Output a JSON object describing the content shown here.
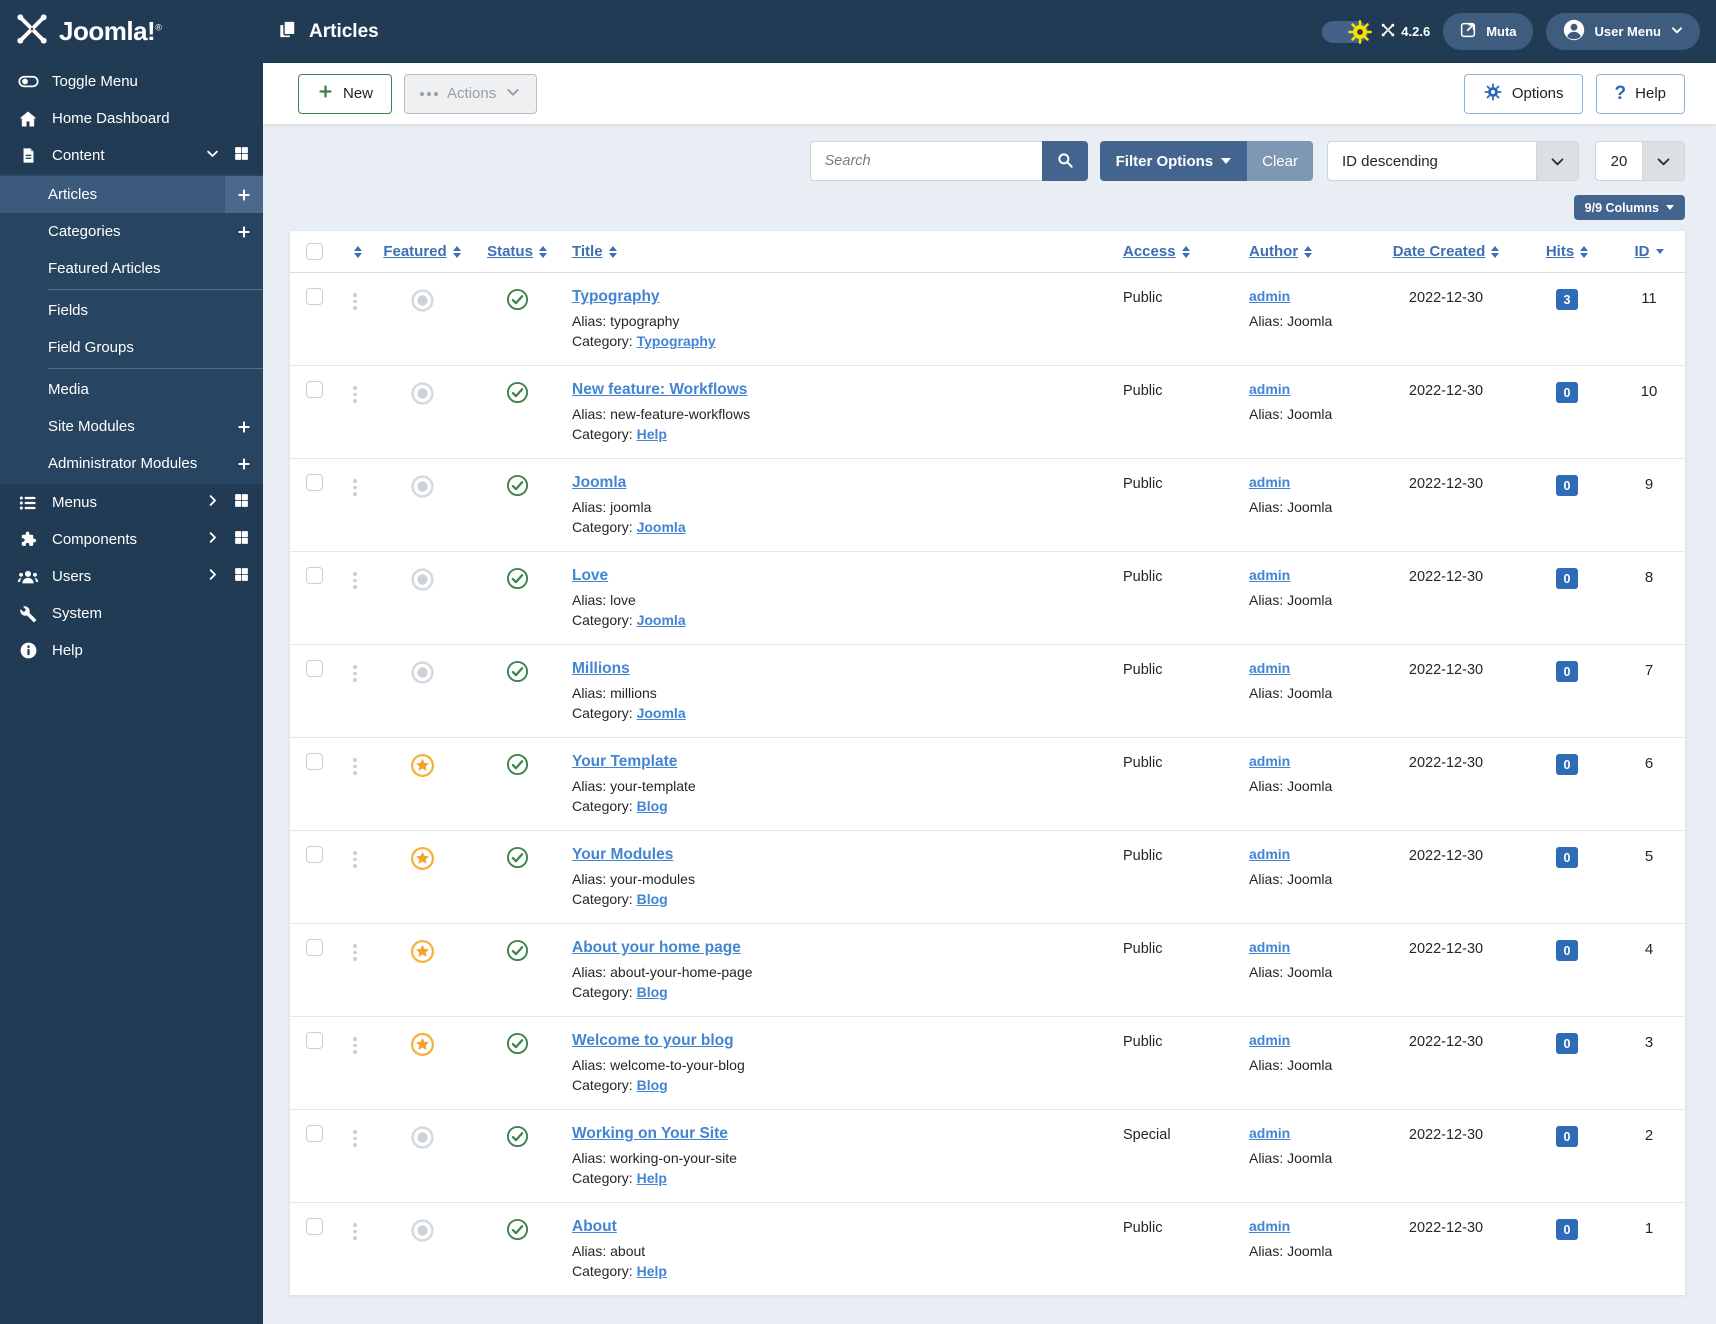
{
  "topbar": {
    "logo_text": "Joomla!",
    "reg_mark": "®",
    "page_title": "Articles",
    "version": "4.2.6",
    "muta_label": "Muta",
    "user_menu_label": "User Menu"
  },
  "sidebar": {
    "items": [
      {
        "label": "Toggle Menu"
      },
      {
        "label": "Home Dashboard"
      },
      {
        "label": "Content"
      },
      {
        "label": "Articles"
      },
      {
        "label": "Categories"
      },
      {
        "label": "Featured Articles"
      },
      {
        "label": "Fields"
      },
      {
        "label": "Field Groups"
      },
      {
        "label": "Media"
      },
      {
        "label": "Site Modules"
      },
      {
        "label": "Administrator Modules"
      },
      {
        "label": "Menus"
      },
      {
        "label": "Components"
      },
      {
        "label": "Users"
      },
      {
        "label": "System"
      },
      {
        "label": "Help"
      }
    ]
  },
  "toolbar": {
    "new_label": "New",
    "actions_label": "Actions",
    "options_label": "Options",
    "help_label": "Help",
    "help_icon_glyph": "?"
  },
  "filters": {
    "search_placeholder": "Search",
    "filter_options_label": "Filter Options",
    "clear_label": "Clear",
    "sort_selected": "ID descending",
    "page_size_selected": "20",
    "columns_badge": "9/9 Columns"
  },
  "table": {
    "headers": {
      "featured": "Featured",
      "status": "Status",
      "title": "Title",
      "access": "Access",
      "author": "Author",
      "date_created": "Date Created",
      "hits": "Hits",
      "id": "ID"
    },
    "labels": {
      "alias": "Alias:",
      "category": "Category:"
    },
    "rows": [
      {
        "title": "Typography",
        "alias": "typography",
        "category": "Typography",
        "access": "Public",
        "author": "admin",
        "author_alias": "Joomla",
        "date": "2022-12-30",
        "hits": "3",
        "id": "11",
        "featured": false
      },
      {
        "title": "New feature: Workflows",
        "alias": "new-feature-workflows",
        "category": "Help",
        "access": "Public",
        "author": "admin",
        "author_alias": "Joomla",
        "date": "2022-12-30",
        "hits": "0",
        "id": "10",
        "featured": false
      },
      {
        "title": "Joomla",
        "alias": "joomla",
        "category": "Joomla",
        "access": "Public",
        "author": "admin",
        "author_alias": "Joomla",
        "date": "2022-12-30",
        "hits": "0",
        "id": "9",
        "featured": false
      },
      {
        "title": "Love",
        "alias": "love",
        "category": "Joomla",
        "access": "Public",
        "author": "admin",
        "author_alias": "Joomla",
        "date": "2022-12-30",
        "hits": "0",
        "id": "8",
        "featured": false
      },
      {
        "title": "Millions",
        "alias": "millions",
        "category": "Joomla",
        "access": "Public",
        "author": "admin",
        "author_alias": "Joomla",
        "date": "2022-12-30",
        "hits": "0",
        "id": "7",
        "featured": false
      },
      {
        "title": "Your Template",
        "alias": "your-template",
        "category": "Blog",
        "access": "Public",
        "author": "admin",
        "author_alias": "Joomla",
        "date": "2022-12-30",
        "hits": "0",
        "id": "6",
        "featured": true
      },
      {
        "title": "Your Modules",
        "alias": "your-modules",
        "category": "Blog",
        "access": "Public",
        "author": "admin",
        "author_alias": "Joomla",
        "date": "2022-12-30",
        "hits": "0",
        "id": "5",
        "featured": true
      },
      {
        "title": "About your home page",
        "alias": "about-your-home-page",
        "category": "Blog",
        "access": "Public",
        "author": "admin",
        "author_alias": "Joomla",
        "date": "2022-12-30",
        "hits": "0",
        "id": "4",
        "featured": true
      },
      {
        "title": "Welcome to your blog",
        "alias": "welcome-to-your-blog",
        "category": "Blog",
        "access": "Public",
        "author": "admin",
        "author_alias": "Joomla",
        "date": "2022-12-30",
        "hits": "0",
        "id": "3",
        "featured": true
      },
      {
        "title": "Working on Your Site",
        "alias": "working-on-your-site",
        "category": "Help",
        "access": "Special",
        "author": "admin",
        "author_alias": "Joomla",
        "date": "2022-12-30",
        "hits": "0",
        "id": "2",
        "featured": false
      },
      {
        "title": "About",
        "alias": "about",
        "category": "Help",
        "access": "Public",
        "author": "admin",
        "author_alias": "Joomla",
        "date": "2022-12-30",
        "hits": "0",
        "id": "1",
        "featured": false
      }
    ]
  },
  "colors": {
    "topbar_bg": "#223b55",
    "submenu_bg": "#274560",
    "active_item_bg": "#3c5a7c",
    "content_bg": "#e8eef3",
    "link_blue": "#4285d3",
    "header_link_blue": "#3d6fb4",
    "steel_blue": "#42648e",
    "clear_button_blue": "#7e97b3",
    "hits_badge_blue": "#2e6cb5",
    "status_green": "#3f8350",
    "featured_orange": "#f0a32c",
    "gear_yellow": "#f7df00",
    "new_button_green": "#3f7f4e"
  }
}
